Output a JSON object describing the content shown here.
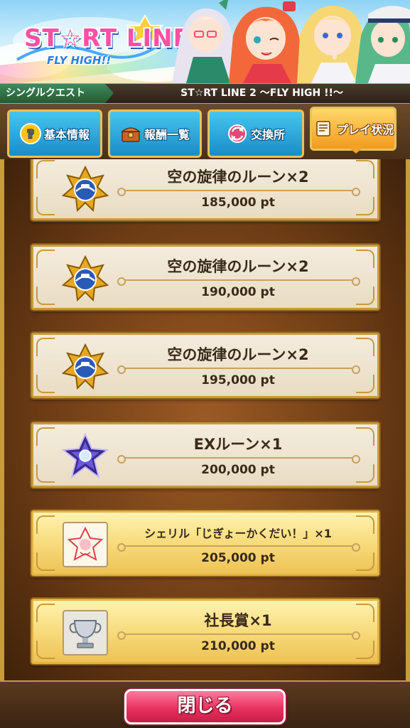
{
  "banner": {
    "logo_main": "ST☆RT LINE 2",
    "logo_sub": "FLY HIGH!!"
  },
  "titlebar": {
    "quest_type": "シングルクエスト",
    "quest_title": "ST☆RT LINE 2 〜FLY HIGH !!〜"
  },
  "tabs": [
    {
      "label": "基本情報",
      "icon": "question-icon",
      "active": false
    },
    {
      "label": "報酬一覧",
      "icon": "treasure-chest-icon",
      "active": false
    },
    {
      "label": "交換所",
      "icon": "exchange-icon",
      "active": false
    },
    {
      "label": "プレイ状況",
      "icon": "scroll-icon",
      "active": true
    }
  ],
  "rewards": [
    {
      "name": "空の旋律のルーン×2",
      "points": "185,000 pt",
      "icon": "sky-rune-medal-icon",
      "highlight": false
    },
    {
      "name": "空の旋律のルーン×2",
      "points": "190,000 pt",
      "icon": "sky-rune-medal-icon",
      "highlight": false
    },
    {
      "name": "空の旋律のルーン×2",
      "points": "195,000 pt",
      "icon": "sky-rune-medal-icon",
      "highlight": false
    },
    {
      "name": "EXルーン×1",
      "points": "200,000 pt",
      "icon": "ex-rune-star-icon",
      "highlight": false
    },
    {
      "name": "シェリル「じぎょーかくだい！」×1",
      "points": "205,000 pt",
      "icon": "stamp-card-icon",
      "highlight": true
    },
    {
      "name": "社長賞×1",
      "points": "210,000 pt",
      "icon": "trophy-icon",
      "highlight": true
    }
  ],
  "footer": {
    "close_label": "閉じる"
  },
  "colors": {
    "tab_blue": "#1a8cc8",
    "tab_active": "#f29a1e",
    "card_border": "#c89a3e",
    "close_button": "#e8325e"
  }
}
